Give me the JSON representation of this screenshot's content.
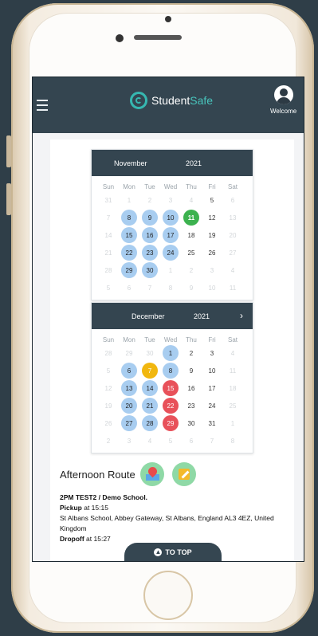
{
  "header": {
    "brand_part1": "Student",
    "brand_part2": "Safe",
    "welcome": "Welcome"
  },
  "days_of_week": [
    "Sun",
    "Mon",
    "Tue",
    "Wed",
    "Thu",
    "Fri",
    "Sat"
  ],
  "calendars": [
    {
      "month": "November",
      "year": "2021",
      "days": [
        {
          "d": "31",
          "s": "muted"
        },
        {
          "d": "1",
          "s": "muted"
        },
        {
          "d": "2",
          "s": "muted"
        },
        {
          "d": "3",
          "s": "muted"
        },
        {
          "d": "4",
          "s": "muted"
        },
        {
          "d": "5",
          "s": ""
        },
        {
          "d": "6",
          "s": "muted"
        },
        {
          "d": "7",
          "s": "muted"
        },
        {
          "d": "8",
          "s": "blue"
        },
        {
          "d": "9",
          "s": "blue"
        },
        {
          "d": "10",
          "s": "blue"
        },
        {
          "d": "11",
          "s": "green"
        },
        {
          "d": "12",
          "s": ""
        },
        {
          "d": "13",
          "s": "muted"
        },
        {
          "d": "14",
          "s": "muted"
        },
        {
          "d": "15",
          "s": "blue"
        },
        {
          "d": "16",
          "s": "blue"
        },
        {
          "d": "17",
          "s": "blue"
        },
        {
          "d": "18",
          "s": ""
        },
        {
          "d": "19",
          "s": ""
        },
        {
          "d": "20",
          "s": "muted"
        },
        {
          "d": "21",
          "s": "muted"
        },
        {
          "d": "22",
          "s": "blue"
        },
        {
          "d": "23",
          "s": "blue"
        },
        {
          "d": "24",
          "s": "blue"
        },
        {
          "d": "25",
          "s": ""
        },
        {
          "d": "26",
          "s": ""
        },
        {
          "d": "27",
          "s": "muted"
        },
        {
          "d": "28",
          "s": "muted"
        },
        {
          "d": "29",
          "s": "blue"
        },
        {
          "d": "30",
          "s": "blue"
        },
        {
          "d": "1",
          "s": "muted"
        },
        {
          "d": "2",
          "s": "muted"
        },
        {
          "d": "3",
          "s": "muted"
        },
        {
          "d": "4",
          "s": "muted"
        },
        {
          "d": "5",
          "s": "muted"
        },
        {
          "d": "6",
          "s": "muted"
        },
        {
          "d": "7",
          "s": "muted"
        },
        {
          "d": "8",
          "s": "muted"
        },
        {
          "d": "9",
          "s": "muted"
        },
        {
          "d": "10",
          "s": "muted"
        },
        {
          "d": "11",
          "s": "muted"
        }
      ]
    },
    {
      "month": "December",
      "year": "2021",
      "next": "›",
      "days": [
        {
          "d": "28",
          "s": "muted"
        },
        {
          "d": "29",
          "s": "muted"
        },
        {
          "d": "30",
          "s": "muted"
        },
        {
          "d": "1",
          "s": "blue"
        },
        {
          "d": "2",
          "s": ""
        },
        {
          "d": "3",
          "s": ""
        },
        {
          "d": "4",
          "s": "muted"
        },
        {
          "d": "5",
          "s": "muted"
        },
        {
          "d": "6",
          "s": "blue"
        },
        {
          "d": "7",
          "s": "yellow"
        },
        {
          "d": "8",
          "s": "blue"
        },
        {
          "d": "9",
          "s": ""
        },
        {
          "d": "10",
          "s": ""
        },
        {
          "d": "11",
          "s": "muted"
        },
        {
          "d": "12",
          "s": "muted"
        },
        {
          "d": "13",
          "s": "blue"
        },
        {
          "d": "14",
          "s": "blue"
        },
        {
          "d": "15",
          "s": "red"
        },
        {
          "d": "16",
          "s": ""
        },
        {
          "d": "17",
          "s": ""
        },
        {
          "d": "18",
          "s": "muted"
        },
        {
          "d": "19",
          "s": "muted"
        },
        {
          "d": "20",
          "s": "blue"
        },
        {
          "d": "21",
          "s": "blue"
        },
        {
          "d": "22",
          "s": "red"
        },
        {
          "d": "23",
          "s": ""
        },
        {
          "d": "24",
          "s": ""
        },
        {
          "d": "25",
          "s": "muted"
        },
        {
          "d": "26",
          "s": "muted"
        },
        {
          "d": "27",
          "s": "blue"
        },
        {
          "d": "28",
          "s": "blue"
        },
        {
          "d": "29",
          "s": "red"
        },
        {
          "d": "30",
          "s": ""
        },
        {
          "d": "31",
          "s": ""
        },
        {
          "d": "1",
          "s": "muted"
        },
        {
          "d": "2",
          "s": "muted"
        },
        {
          "d": "3",
          "s": "muted"
        },
        {
          "d": "4",
          "s": "muted"
        },
        {
          "d": "5",
          "s": "muted"
        },
        {
          "d": "6",
          "s": "muted"
        },
        {
          "d": "7",
          "s": "muted"
        },
        {
          "d": "8",
          "s": "muted"
        }
      ]
    }
  ],
  "route": {
    "title": "Afternoon Route",
    "trip_name": "2PM TEST2 / Demo School.",
    "pickup_label": "Pickup",
    "pickup_time": " at 15:15",
    "pickup_address": "St Albans School, Abbey Gateway, St Albans, England AL3 4EZ, United Kingdom",
    "dropoff_label": "Dropoff",
    "dropoff_time": " at 15:27"
  },
  "to_top": "TO TOP",
  "colors": {
    "header": "#344550",
    "scheduled": "#a8cdf0",
    "today": "#3cb24f",
    "pending": "#f1b70f",
    "cancelled": "#e8515a"
  }
}
